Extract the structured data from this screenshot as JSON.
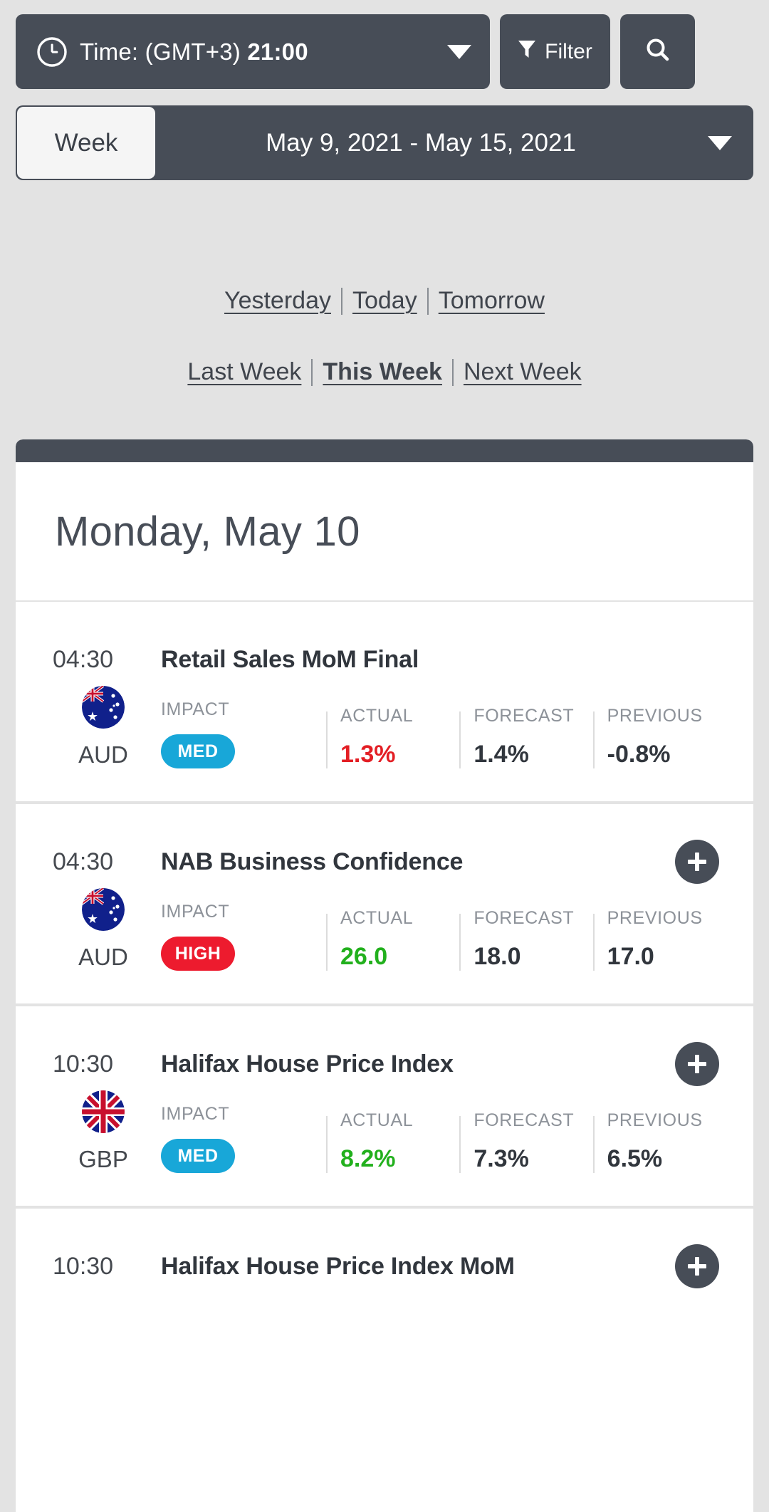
{
  "toolbar": {
    "time_label": "Time: (GMT+3) ",
    "time_value": "21:00",
    "clock_icon": "clock-icon",
    "dropdown_icon": "chevron-down-icon",
    "filter_label": "Filter",
    "filter_icon": "funnel-icon",
    "search_icon": "search-icon"
  },
  "weekbar": {
    "mode_label": "Week",
    "range_label": "May 9, 2021 - May 15, 2021",
    "dropdown_icon": "chevron-down-icon"
  },
  "quicknav": {
    "row1": [
      {
        "label": "Yesterday",
        "active": false
      },
      {
        "label": "Today",
        "active": false
      },
      {
        "label": "Tomorrow",
        "active": false
      }
    ],
    "row2": [
      {
        "label": "Last Week",
        "active": false
      },
      {
        "label": "This Week",
        "active": true
      },
      {
        "label": "Next Week",
        "active": false
      }
    ]
  },
  "calendar": {
    "day_title": "Monday, May 10",
    "column_headers": {
      "impact": "IMPACT",
      "actual": "ACTUAL",
      "forecast": "FORECAST",
      "previous": "PREVIOUS"
    },
    "events": [
      {
        "time": "04:30",
        "title": "Retail Sales MoM Final",
        "currency": "AUD",
        "flag": "flag-australia",
        "impact": "MED",
        "impact_level": "med",
        "actual": "1.3%",
        "actual_tone": "red",
        "forecast": "1.4%",
        "previous": "-0.8%",
        "has_expand": false,
        "expand_icon": "plus-icon"
      },
      {
        "time": "04:30",
        "title": "NAB Business Confidence",
        "currency": "AUD",
        "flag": "flag-australia",
        "impact": "HIGH",
        "impact_level": "high",
        "actual": "26.0",
        "actual_tone": "green",
        "forecast": "18.0",
        "previous": "17.0",
        "has_expand": true,
        "expand_icon": "plus-icon"
      },
      {
        "time": "10:30",
        "title": "Halifax House Price Index",
        "currency": "GBP",
        "flag": "flag-uk",
        "impact": "MED",
        "impact_level": "med",
        "actual": "8.2%",
        "actual_tone": "green",
        "forecast": "7.3%",
        "previous": "6.5%",
        "has_expand": true,
        "expand_icon": "plus-icon"
      },
      {
        "time": "10:30",
        "title": "Halifax House Price Index MoM",
        "currency": "",
        "flag": "",
        "impact": "",
        "impact_level": "",
        "actual": "",
        "actual_tone": "",
        "forecast": "",
        "previous": "",
        "has_expand": true,
        "expand_icon": "plus-icon"
      }
    ]
  },
  "colors": {
    "dark": "#474d57",
    "page_bg": "#e3e3e3",
    "med_badge": "#18a7d8",
    "high_badge": "#ed1b2e",
    "positive": "#22b01d",
    "negative": "#e31e24"
  }
}
